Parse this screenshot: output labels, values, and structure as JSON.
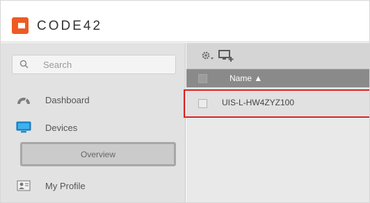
{
  "app": {
    "logo_text": "CODE42",
    "brand_color": "#ee5a24"
  },
  "sidebar": {
    "search": {
      "placeholder": "Search",
      "value": "",
      "icon": "search-icon"
    },
    "items": [
      {
        "label": "Dashboard",
        "icon": "dashboard-icon"
      },
      {
        "label": "Devices",
        "icon": "monitor-icon"
      },
      {
        "label": "Overview",
        "selected": true
      },
      {
        "label": "My Profile",
        "icon": "profile-card-icon"
      }
    ]
  },
  "main": {
    "toolbar": {
      "icons": [
        "gear-menu-icon",
        "add-device-icon"
      ]
    },
    "table": {
      "columns": [
        {
          "label": "Name ▲",
          "sort": "ascending"
        }
      ],
      "rows": [
        {
          "name": "UIS-L-HW4ZYZ100",
          "checked": false
        }
      ]
    }
  },
  "annotation": {
    "highlight_color": "#e02020"
  }
}
